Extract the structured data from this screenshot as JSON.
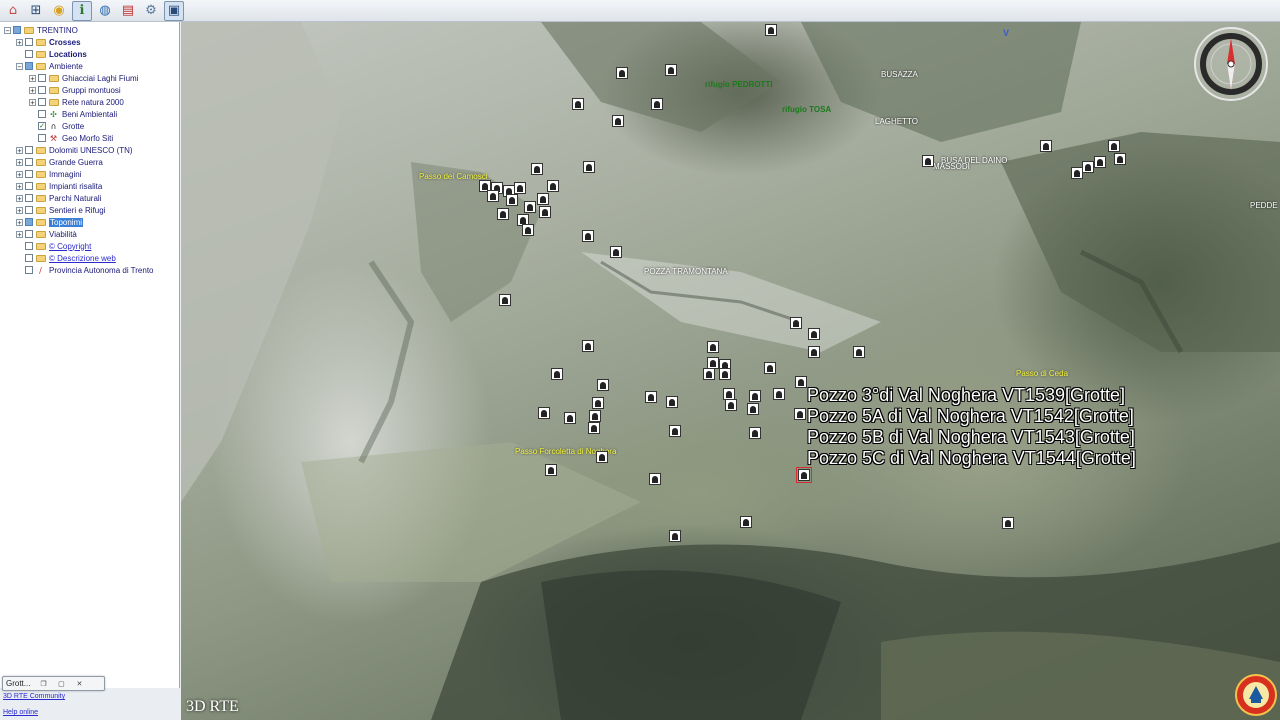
{
  "toolbar": {
    "icons": [
      "home-icon",
      "grid-icon",
      "target-icon",
      "info-icon",
      "globe-icon",
      "pdf-icon",
      "gear-icon",
      "monitor-icon"
    ]
  },
  "tree": {
    "root": "TRENTINO",
    "crosses": "Crosses",
    "locations": "Locations",
    "ambiente": "Ambiente",
    "ghiacciai": "Ghiacciai Laghi Fiumi",
    "gruppi": "Gruppi montuosi",
    "rete": "Rete natura 2000",
    "beni": "Beni Ambientali",
    "grotte": "Grotte",
    "geomorfo": "Geo Morfo Siti",
    "dolomiti": "Dolomiti UNESCO (TN)",
    "guerra": "Grande Guerra",
    "immagini": "Immagini",
    "impianti": "Impianti risalita",
    "parchi": "Parchi Naturali",
    "sentieri": "Sentieri e Rifugi",
    "toponimi": "Toponimi",
    "viabilita": "Viabilità",
    "copyright": "© Copyright",
    "descrizione": "© Descrizione web",
    "provincia": "Provincia Autonoma di Trento"
  },
  "mini_window": {
    "title": "Grott..."
  },
  "footer": {
    "community": "3D RTE Community",
    "help": "Help online"
  },
  "map": {
    "brand": "3D RTE",
    "north_letter": "V",
    "places": {
      "busazza": "BUSAZZA",
      "laghetto": "LAGHETTO",
      "busa": "BUSA DEL DAINO",
      "massodi": "MASSODI",
      "pozza": "POZZA TRAMONTANA",
      "pedd": "PEDDE"
    },
    "passes": {
      "p1": "Passo dei Camosci",
      "p2": "Passo di Ceda",
      "p3": "Passo Forcoletta di Noghera"
    },
    "huts": {
      "pedrotti": "rifugio PEDROTTI",
      "tosa": "rifugio TOSA"
    },
    "popup_lines": [
      "Pozzo 3°di Val Noghera VT1539[Grotte]",
      "Pozzo 5A di Val Noghera VT1542[Grotte]",
      "Pozzo 5B di Val Noghera VT1543[Grotte]",
      "Pozzo 5C di Val Noghera VT1544[Grotte]"
    ]
  }
}
